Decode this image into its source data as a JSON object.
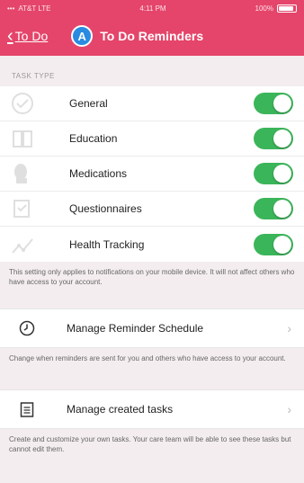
{
  "status_bar": {
    "carrier": "AT&T LTE",
    "time": "4:11 PM",
    "battery": "100%"
  },
  "nav": {
    "back_label": "To Do",
    "avatar_letter": "A",
    "title": "To Do Reminders"
  },
  "section": {
    "header": "TASK TYPE",
    "items": [
      {
        "label": "General",
        "enabled": true,
        "icon": "check-circle-icon"
      },
      {
        "label": "Education",
        "enabled": true,
        "icon": "book-icon"
      },
      {
        "label": "Medications",
        "enabled": true,
        "icon": "pill-icon"
      },
      {
        "label": "Questionnaires",
        "enabled": true,
        "icon": "questionnaire-icon"
      },
      {
        "label": "Health Tracking",
        "enabled": true,
        "icon": "trend-icon"
      }
    ],
    "note": "This setting only applies to notifications on your mobile device. It will not affect others who have access to your account."
  },
  "schedule": {
    "label": "Manage Reminder Schedule",
    "icon": "clock-icon",
    "note": "Change when reminders are sent for you and others who have access to your account."
  },
  "created_tasks": {
    "label": "Manage created tasks",
    "icon": "clipboard-icon",
    "note": "Create and customize your own tasks. Your care team will be able to see these tasks but cannot edit them."
  },
  "colors": {
    "header": "#e5456a",
    "toggle_on": "#3bb55a",
    "avatar": "#2a8be0"
  }
}
